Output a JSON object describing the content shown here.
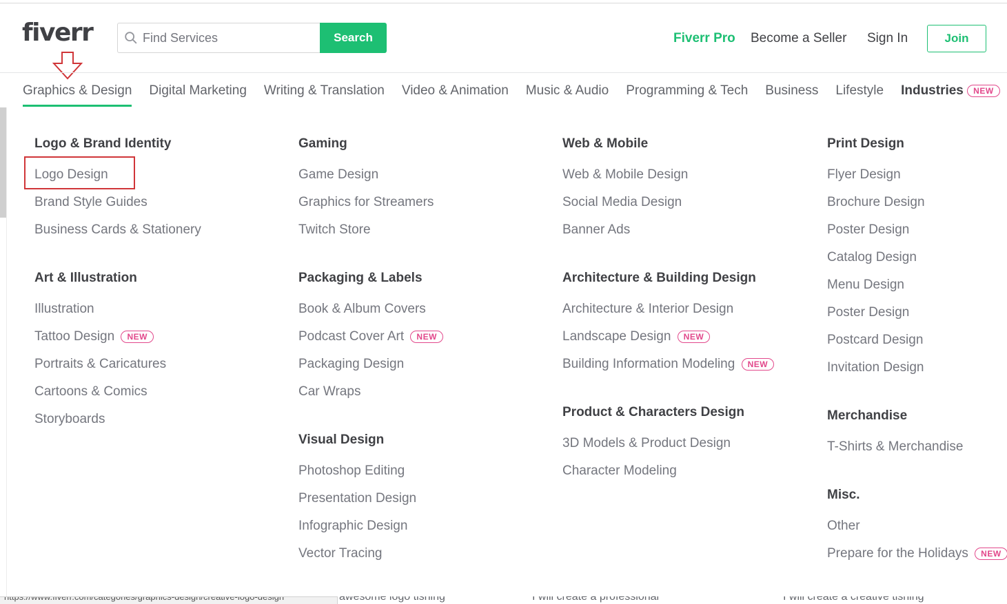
{
  "header": {
    "logo": "fiverr",
    "search": {
      "placeholder": "Find Services",
      "button_label": "Search"
    },
    "links": {
      "pro": "Fiverr Pro",
      "seller": "Become a Seller",
      "signin": "Sign In",
      "join": "Join"
    }
  },
  "nav": {
    "items": [
      "Graphics & Design",
      "Digital Marketing",
      "Writing & Translation",
      "Video & Animation",
      "Music & Audio",
      "Programming & Tech",
      "Business",
      "Lifestyle",
      "Industries"
    ],
    "industries_badge": "NEW"
  },
  "menu": {
    "col1": {
      "g1": {
        "title": "Logo & Brand Identity",
        "items": [
          "Logo Design",
          "Brand Style Guides",
          "Business Cards & Stationery"
        ]
      },
      "g2": {
        "title": "Art & Illustration",
        "items": [
          "Illustration",
          "Tattoo Design",
          "Portraits & Caricatures",
          "Cartoons & Comics",
          "Storyboards"
        ]
      }
    },
    "col2": {
      "g1": {
        "title": "Gaming",
        "items": [
          "Game Design",
          "Graphics for Streamers",
          "Twitch Store"
        ]
      },
      "g2": {
        "title": "Packaging & Labels",
        "items": [
          "Book & Album Covers",
          "Podcast Cover Art",
          "Packaging Design",
          "Car Wraps"
        ]
      },
      "g3": {
        "title": "Visual Design",
        "items": [
          "Photoshop Editing",
          "Presentation Design",
          "Infographic Design",
          "Vector Tracing"
        ]
      }
    },
    "col3": {
      "g1": {
        "title": "Web & Mobile",
        "items": [
          "Web & Mobile Design",
          "Social Media Design",
          "Banner Ads"
        ]
      },
      "g2": {
        "title": "Architecture & Building Design",
        "items": [
          "Architecture & Interior Design",
          "Landscape Design",
          "Building Information Modeling"
        ]
      },
      "g3": {
        "title": "Product & Characters Design",
        "items": [
          "3D Models & Product Design",
          "Character Modeling"
        ]
      }
    },
    "col4": {
      "g1": {
        "title": "Print Design",
        "items": [
          "Flyer Design",
          "Brochure Design",
          "Poster Design",
          "Catalog Design",
          "Menu Design",
          "Poster Design",
          "Postcard Design",
          "Invitation Design"
        ]
      },
      "g2": {
        "title": "Merchandise",
        "items": [
          "T-Shirts & Merchandise"
        ]
      },
      "g3": {
        "title": "Misc.",
        "items": [
          "Other",
          "Prepare for the Holidays"
        ]
      }
    },
    "new_badge": "NEW"
  },
  "background": {
    "peek": [
      "awesome logo tisning",
      "I will create a professional",
      "I will create a creative tisning"
    ],
    "status_url": "https://www.fiverr.com/categories/graphics-design/creative-logo-design"
  },
  "colors": {
    "brand_green": "#1dbf73",
    "new_badge": "#e2488b",
    "annotation_red": "#d03538",
    "text_dark": "#404145",
    "text_muted": "#74767e"
  }
}
